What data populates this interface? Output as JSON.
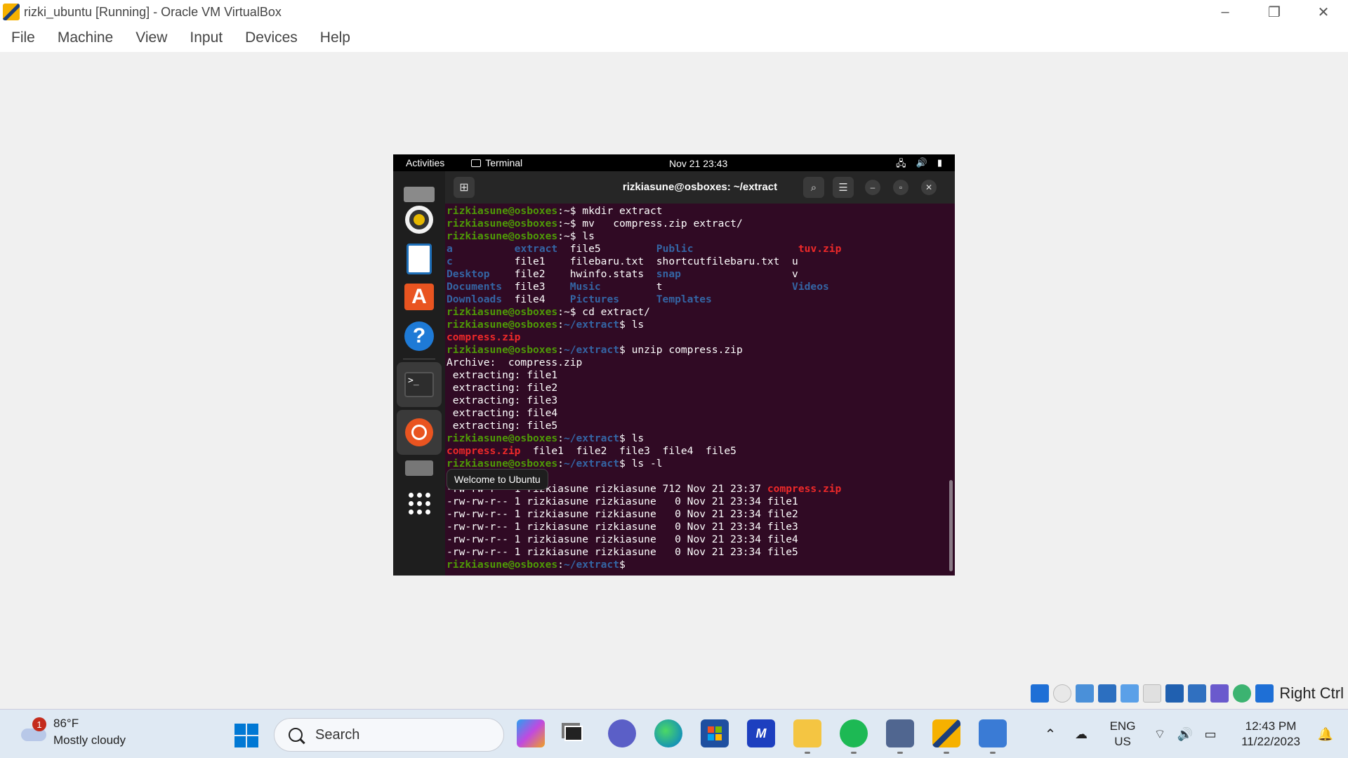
{
  "window": {
    "title": "rizki_ubuntu [Running] - Oracle VM VirtualBox",
    "minimize": "–",
    "restore": "❐",
    "close": "✕"
  },
  "menu": [
    "File",
    "Machine",
    "View",
    "Input",
    "Devices",
    "Help"
  ],
  "guest": {
    "topbar": {
      "activities": "Activities",
      "app": "Terminal",
      "clock": "Nov 21  23:43"
    },
    "tooltip": "Welcome to Ubuntu",
    "terminal": {
      "title": "rizkiasune@osboxes: ~/extract",
      "user": "rizkiasune@osboxes",
      "lines": [
        {
          "segs": [
            [
              "u",
              "rizkiasune@osboxes"
            ],
            [
              "n",
              ":~$ mkdir extract"
            ]
          ]
        },
        {
          "segs": [
            [
              "u",
              "rizkiasune@osboxes"
            ],
            [
              "n",
              ":~$ mv   compress.zip extract/"
            ]
          ]
        },
        {
          "segs": [
            [
              "u",
              "rizkiasune@osboxes"
            ],
            [
              "n",
              ":~$ ls"
            ]
          ]
        },
        {
          "segs": [
            [
              "d",
              "a"
            ],
            [
              "n",
              "          "
            ],
            [
              "d",
              "extract"
            ],
            [
              "n",
              "  file5         "
            ],
            [
              "d",
              "Public"
            ],
            [
              "n",
              "                 "
            ],
            [
              "z",
              "tuv.zip"
            ]
          ]
        },
        {
          "segs": [
            [
              "d",
              "c"
            ],
            [
              "n",
              "          file1    filebaru.txt  shortcutfilebaru.txt  u"
            ]
          ]
        },
        {
          "segs": [
            [
              "d",
              "Desktop"
            ],
            [
              "n",
              "    file2    hwinfo.stats  "
            ],
            [
              "d",
              "snap"
            ],
            [
              "n",
              "                  v"
            ]
          ]
        },
        {
          "segs": [
            [
              "d",
              "Documents"
            ],
            [
              "n",
              "  file3    "
            ],
            [
              "d",
              "Music"
            ],
            [
              "n",
              "         t                     "
            ],
            [
              "d",
              "Videos"
            ]
          ]
        },
        {
          "segs": [
            [
              "d",
              "Downloads"
            ],
            [
              "n",
              "  file4    "
            ],
            [
              "d",
              "Pictures"
            ],
            [
              "n",
              "      "
            ],
            [
              "d",
              "Templates"
            ]
          ]
        },
        {
          "segs": [
            [
              "u",
              "rizkiasune@osboxes"
            ],
            [
              "n",
              ":~$ cd extract/"
            ]
          ]
        },
        {
          "segs": [
            [
              "u",
              "rizkiasune@osboxes"
            ],
            [
              "n",
              ":"
            ],
            [
              "p",
              "~/extract"
            ],
            [
              "n",
              "$ ls"
            ]
          ]
        },
        {
          "segs": [
            [
              "z",
              "compress.zip"
            ]
          ]
        },
        {
          "segs": [
            [
              "u",
              "rizkiasune@osboxes"
            ],
            [
              "n",
              ":"
            ],
            [
              "p",
              "~/extract"
            ],
            [
              "n",
              "$ unzip compress.zip"
            ]
          ]
        },
        {
          "segs": [
            [
              "n",
              "Archive:  compress.zip"
            ]
          ]
        },
        {
          "segs": [
            [
              "n",
              " extracting: file1"
            ]
          ]
        },
        {
          "segs": [
            [
              "n",
              " extracting: file2"
            ]
          ]
        },
        {
          "segs": [
            [
              "n",
              " extracting: file3"
            ]
          ]
        },
        {
          "segs": [
            [
              "n",
              " extracting: file4"
            ]
          ]
        },
        {
          "segs": [
            [
              "n",
              " extracting: file5"
            ]
          ]
        },
        {
          "segs": [
            [
              "u",
              "rizkiasune@osboxes"
            ],
            [
              "n",
              ":"
            ],
            [
              "p",
              "~/extract"
            ],
            [
              "n",
              "$ ls"
            ]
          ]
        },
        {
          "segs": [
            [
              "z",
              "compress.zip"
            ],
            [
              "n",
              "  file1  file2  file3  file4  file5"
            ]
          ]
        },
        {
          "segs": [
            [
              "u",
              "rizkiasune@osboxes"
            ],
            [
              "n",
              ":"
            ],
            [
              "p",
              "~/extract"
            ],
            [
              "n",
              "$ ls -l"
            ]
          ]
        },
        {
          "segs": [
            [
              "n",
              ""
            ]
          ]
        },
        {
          "segs": [
            [
              "n",
              "-rw-rw-r-- 1 rizkiasune rizkiasune 712 Nov 21 23:37 "
            ],
            [
              "z",
              "compress.zip"
            ]
          ]
        },
        {
          "segs": [
            [
              "n",
              "-rw-rw-r-- 1 rizkiasune rizkiasune   0 Nov 21 23:34 file1"
            ]
          ]
        },
        {
          "segs": [
            [
              "n",
              "-rw-rw-r-- 1 rizkiasune rizkiasune   0 Nov 21 23:34 file2"
            ]
          ]
        },
        {
          "segs": [
            [
              "n",
              "-rw-rw-r-- 1 rizkiasune rizkiasune   0 Nov 21 23:34 file3"
            ]
          ]
        },
        {
          "segs": [
            [
              "n",
              "-rw-rw-r-- 1 rizkiasune rizkiasune   0 Nov 21 23:34 file4"
            ]
          ]
        },
        {
          "segs": [
            [
              "n",
              "-rw-rw-r-- 1 rizkiasune rizkiasune   0 Nov 21 23:34 file5"
            ]
          ]
        },
        {
          "segs": [
            [
              "u",
              "rizkiasune@osboxes"
            ],
            [
              "n",
              ":"
            ],
            [
              "p",
              "~/extract"
            ],
            [
              "n",
              "$"
            ]
          ]
        }
      ]
    }
  },
  "statusbar": {
    "host_key": "Right Ctrl"
  },
  "taskbar": {
    "weather_temp": "86°F",
    "weather_desc": "Mostly cloudy",
    "weather_badge": "1",
    "search_placeholder": "Search",
    "lang_top": "ENG",
    "lang_bottom": "US",
    "time": "12:43 PM",
    "date": "11/22/2023"
  },
  "colors": {
    "terminal_bg": "#300a24",
    "prompt_user": "#4e9a06",
    "prompt_path": "#3465a4",
    "archive": "#ef2929",
    "ubuntu_orange": "#e95420"
  }
}
